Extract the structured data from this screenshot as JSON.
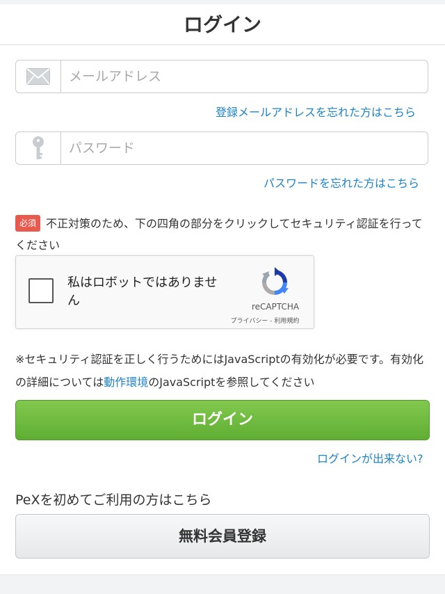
{
  "header": {
    "title": "ログイン"
  },
  "email": {
    "placeholder": "メールアドレス",
    "forgot_link": "登録メールアドレスを忘れた方はこちら"
  },
  "password": {
    "placeholder": "パスワード",
    "forgot_link": "パスワードを忘れた方はこちら"
  },
  "security": {
    "required_badge": "必須",
    "notice": "不正対策のため、下の四角の部分をクリックしてセキュリティ認証を行ってください"
  },
  "captcha": {
    "label": "私はロボットではありません",
    "brand": "reCAPTCHA",
    "links": "プライバシー - 利用規約"
  },
  "javascript_notice": {
    "before": "※セキュリティ認証を正しく行うためにはJavaScriptの有効化が必要です。有効化の詳細については",
    "link": "動作環境",
    "after": "のJavaScriptを参照してください"
  },
  "login_button": "ログイン",
  "cant_login_link": "ログインが出来ない?",
  "first_time_text": "PeXを初めてご利用の方はこちら",
  "register_button": "無料会員登録",
  "colors": {
    "primary_green": "#6cbb3f",
    "link_blue": "#1c83c6",
    "required_red": "#e8594e"
  },
  "icons": {
    "email": "envelope-icon",
    "password": "key-icon",
    "captcha": "recaptcha-logo-icon"
  }
}
